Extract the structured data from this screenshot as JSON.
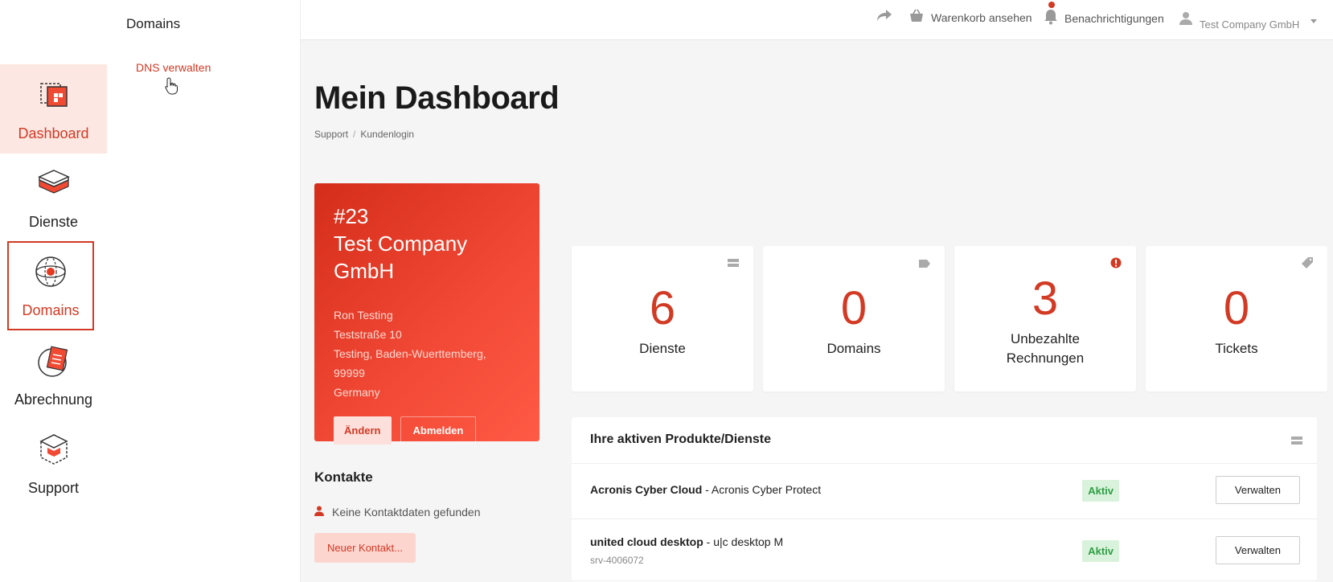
{
  "rail": {
    "items": [
      {
        "label": "Dashboard"
      },
      {
        "label": "Dienste"
      },
      {
        "label": "Domains"
      },
      {
        "label": "Abrechnung"
      },
      {
        "label": "Support"
      }
    ]
  },
  "subnav": {
    "title": "Domains",
    "links": [
      {
        "label": "DNS verwalten"
      }
    ]
  },
  "topbar": {
    "cart_label": "Warenkorb ansehen",
    "notifications_label": "Benachrichtigungen",
    "user_label": "Test Company GmbH"
  },
  "page": {
    "title": "Mein Dashboard",
    "breadcrumb": [
      "Support",
      "Kundenlogin"
    ]
  },
  "profile": {
    "number": "#23",
    "company": "Test Company GmbH",
    "name": "Ron Testing",
    "street": "Teststraße 10",
    "city": "Testing, Baden-Wuerttemberg, 99999",
    "country": "Germany",
    "edit_label": "Ändern",
    "logout_label": "Abmelden"
  },
  "contacts": {
    "title": "Kontakte",
    "empty_text": "Keine Kontaktdaten gefunden",
    "new_label": "Neuer Kontakt..."
  },
  "stats": [
    {
      "value": "6",
      "label": "Dienste"
    },
    {
      "value": "0",
      "label": "Domains"
    },
    {
      "value": "3",
      "label": "Unbezahlte Rechnungen"
    },
    {
      "value": "0",
      "label": "Tickets"
    }
  ],
  "products": {
    "title": "Ihre aktiven Produkte/Dienste",
    "rows": [
      {
        "name": "Acronis Cyber Cloud",
        "detail": " - Acronis Cyber Protect",
        "sub": "",
        "status": "Aktiv",
        "action": "Verwalten"
      },
      {
        "name": "united cloud desktop",
        "detail": " - u|c desktop M",
        "sub": "srv-4006072",
        "status": "Aktiv",
        "action": "Verwalten"
      }
    ]
  },
  "colors": {
    "accent": "#d23a24",
    "success": "#2f9e44"
  }
}
